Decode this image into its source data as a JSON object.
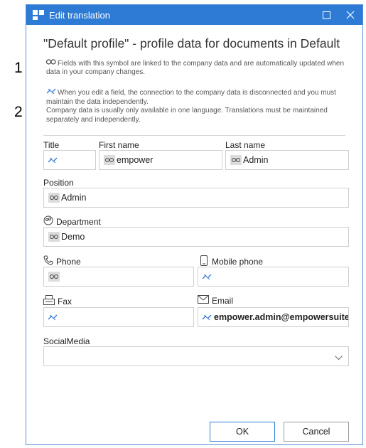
{
  "annotations": {
    "one": "1",
    "two": "2"
  },
  "window": {
    "title": "Edit translation"
  },
  "heading": "\"Default profile\" - profile data for documents in Default",
  "info": {
    "linked": "Fields with this symbol are linked to the company data and are automatically updated when data in your company changes.",
    "edit_line1": "When you edit a field, the connection to the company data is disconnected and you must maintain the data independently.",
    "edit_line2": "Company data is usually only available in one language. Translations must be maintained separately and independently."
  },
  "fields": {
    "title": {
      "label": "Title",
      "value": ""
    },
    "first_name": {
      "label": "First name",
      "value": "empower"
    },
    "last_name": {
      "label": "Last name",
      "value": "Admin"
    },
    "position": {
      "label": "Position",
      "value": "Admin"
    },
    "department": {
      "label": "Department",
      "value": "Demo"
    },
    "phone": {
      "label": "Phone",
      "value": ""
    },
    "mobile": {
      "label": "Mobile phone",
      "value": ""
    },
    "fax": {
      "label": "Fax",
      "value": ""
    },
    "email": {
      "label": "Email",
      "value": "empower.admin@empowersuite"
    },
    "social": {
      "label": "SocialMedia",
      "value": ""
    }
  },
  "buttons": {
    "ok": "OK",
    "cancel": "Cancel"
  },
  "colors": {
    "titlebar": "#2e7bd6",
    "broken_link": "#3a7bd5",
    "link_chip": "#dcdcdc"
  },
  "icons": [
    "link-icon",
    "broken-link-icon",
    "department-icon",
    "phone-icon",
    "mobile-phone-icon",
    "fax-icon",
    "email-icon",
    "chevron-down-icon",
    "restore-icon",
    "close-icon"
  ]
}
